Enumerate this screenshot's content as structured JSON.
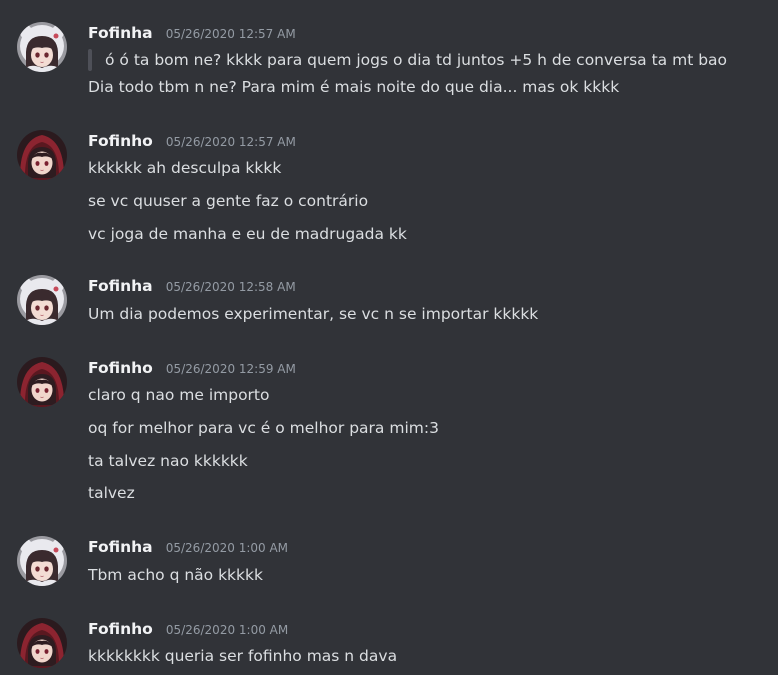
{
  "colors": {
    "background": "#313338",
    "username": "#f2f3f5",
    "timestamp": "#949ba4",
    "text": "#dbdee1",
    "quote_bar": "#4e5058"
  },
  "messages": [
    {
      "username": "Fofinha",
      "timestamp": "05/26/2020 12:57 AM",
      "avatar": "anime-girl-white-hood-avatar",
      "quote": "ó ó ta bom ne? kkkk para  quem jogs o dia td juntos +5 h de conversa ta mt bao",
      "lines": [
        "Dia todo tbm n ne? Para mim é mais noite do que dia... mas ok kkkk"
      ]
    },
    {
      "username": "Fofinho",
      "timestamp": "05/26/2020 12:57 AM",
      "avatar": "anime-girl-red-hood-avatar",
      "lines": [
        "kkkkkk ah desculpa kkkk",
        "se vc quuser a gente faz o contrário",
        "vc joga de manha e eu de madrugada kk"
      ]
    },
    {
      "username": "Fofinha",
      "timestamp": "05/26/2020 12:58 AM",
      "avatar": "anime-girl-white-hood-avatar",
      "lines": [
        "Um dia podemos experimentar, se vc n se importar kkkkk"
      ]
    },
    {
      "username": "Fofinho",
      "timestamp": "05/26/2020 12:59 AM",
      "avatar": "anime-girl-red-hood-avatar",
      "lines": [
        "claro q nao me importo",
        "oq for melhor para vc é o melhor para mim:3",
        "ta talvez nao kkkkkk",
        "talvez"
      ]
    },
    {
      "username": "Fofinha",
      "timestamp": "05/26/2020 1:00 AM",
      "avatar": "anime-girl-white-hood-avatar",
      "lines": [
        "Tbm acho q não kkkkk"
      ]
    },
    {
      "username": "Fofinho",
      "timestamp": "05/26/2020 1:00 AM",
      "avatar": "anime-girl-red-hood-avatar",
      "lines": [
        "kkkkkkkk queria ser fofinho mas n dava"
      ]
    }
  ]
}
